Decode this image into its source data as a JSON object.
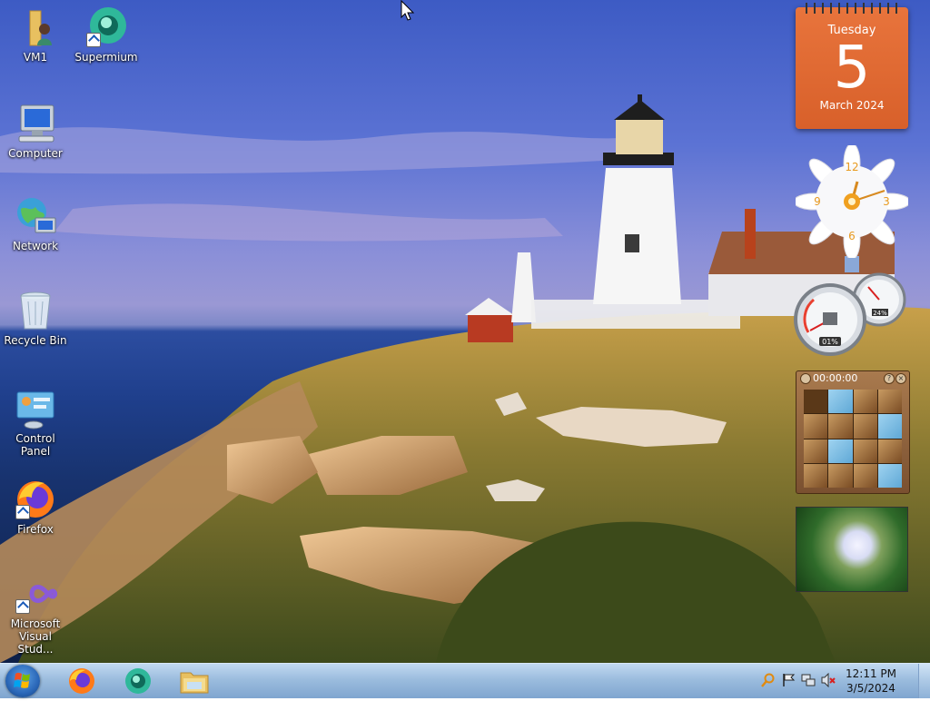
{
  "desktop_icons": [
    {
      "label": "VM1"
    },
    {
      "label": "Supermium"
    },
    {
      "label": "Computer"
    },
    {
      "label": "Network"
    },
    {
      "label": "Recycle Bin"
    },
    {
      "label": "Control Panel"
    },
    {
      "label": "Firefox"
    },
    {
      "label": "Microsoft Visual Stud..."
    }
  ],
  "gadgets": {
    "calendar": {
      "weekday": "Tuesday",
      "day": "5",
      "month_year": "March 2024"
    },
    "clock": {
      "numerals": [
        "12",
        "3",
        "6",
        "9"
      ]
    },
    "cpu_meter": {
      "cpu_percent": "01%",
      "memory_percent": "24%"
    },
    "puzzle": {
      "timer": "00:00:00",
      "help_button": "?",
      "close_button": "×"
    }
  },
  "taskbar": {
    "pinned": [
      "Firefox",
      "Supermium",
      "Windows Explorer"
    ],
    "tray": {
      "time": "12:11 PM",
      "date": "3/5/2024"
    }
  },
  "colors": {
    "calendar_orange": "#d8602a",
    "taskbar_blue": "#96b9dc"
  }
}
